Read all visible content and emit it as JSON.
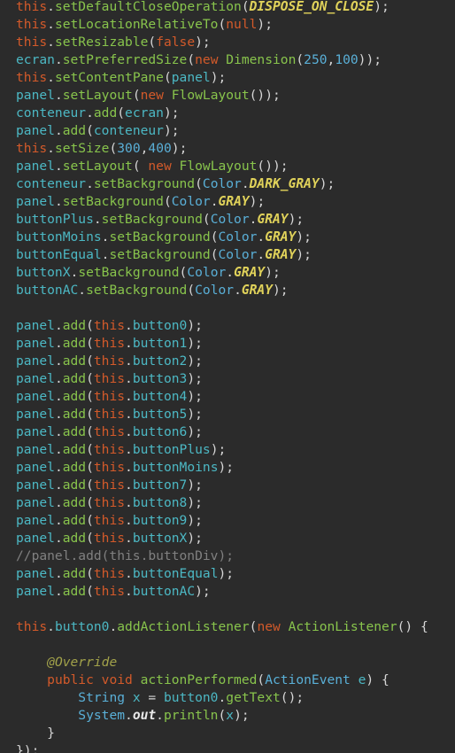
{
  "editor": {
    "language": "java",
    "colors": {
      "background": "#2b2b2b",
      "keyword": "#d35a2a",
      "identifier": "#4cb8c4",
      "method": "#88c44c",
      "type": "#5ab0d8",
      "constant": "#e0d25a",
      "number": "#5ab0d8",
      "plain": "#d6d6d6",
      "comment": "#808080",
      "annotation": "#a2a24a"
    },
    "lines": [
      [
        [
          "kw",
          "this"
        ],
        [
          "plain",
          "."
        ],
        [
          "method",
          "setDefaultCloseOperation"
        ],
        [
          "plain",
          "("
        ],
        [
          "const",
          "DISPOSE_ON_CLOSE"
        ],
        [
          "plain",
          ");"
        ]
      ],
      [
        [
          "kw",
          "this"
        ],
        [
          "plain",
          "."
        ],
        [
          "method",
          "setLocationRelativeTo"
        ],
        [
          "plain",
          "("
        ],
        [
          "kw",
          "null"
        ],
        [
          "plain",
          ");"
        ]
      ],
      [
        [
          "kw",
          "this"
        ],
        [
          "plain",
          "."
        ],
        [
          "method",
          "setResizable"
        ],
        [
          "plain",
          "("
        ],
        [
          "kw",
          "false"
        ],
        [
          "plain",
          ");"
        ]
      ],
      [
        [
          "var",
          "ecran"
        ],
        [
          "plain",
          "."
        ],
        [
          "method",
          "setPreferredSize"
        ],
        [
          "plain",
          "("
        ],
        [
          "kw",
          "new "
        ],
        [
          "method",
          "Dimension"
        ],
        [
          "plain",
          "("
        ],
        [
          "num",
          "250"
        ],
        [
          "plain",
          ","
        ],
        [
          "num",
          "100"
        ],
        [
          "plain",
          "));"
        ]
      ],
      [
        [
          "kw",
          "this"
        ],
        [
          "plain",
          "."
        ],
        [
          "method",
          "setContentPane"
        ],
        [
          "plain",
          "("
        ],
        [
          "var",
          "panel"
        ],
        [
          "plain",
          ");"
        ]
      ],
      [
        [
          "var",
          "panel"
        ],
        [
          "plain",
          "."
        ],
        [
          "method",
          "setLayout"
        ],
        [
          "plain",
          "("
        ],
        [
          "kw",
          "new "
        ],
        [
          "method",
          "FlowLayout"
        ],
        [
          "plain",
          "());"
        ]
      ],
      [
        [
          "var",
          "conteneur"
        ],
        [
          "plain",
          "."
        ],
        [
          "method",
          "add"
        ],
        [
          "plain",
          "("
        ],
        [
          "var",
          "ecran"
        ],
        [
          "plain",
          ");"
        ]
      ],
      [
        [
          "var",
          "panel"
        ],
        [
          "plain",
          "."
        ],
        [
          "method",
          "add"
        ],
        [
          "plain",
          "("
        ],
        [
          "var",
          "conteneur"
        ],
        [
          "plain",
          ");"
        ]
      ],
      [
        [
          "kw",
          "this"
        ],
        [
          "plain",
          "."
        ],
        [
          "method",
          "setSize"
        ],
        [
          "plain",
          "("
        ],
        [
          "num",
          "300"
        ],
        [
          "plain",
          ","
        ],
        [
          "num",
          "400"
        ],
        [
          "plain",
          ");"
        ]
      ],
      [
        [
          "var",
          "panel"
        ],
        [
          "plain",
          "."
        ],
        [
          "method",
          "setLayout"
        ],
        [
          "plain",
          "( "
        ],
        [
          "kw",
          "new "
        ],
        [
          "method",
          "FlowLayout"
        ],
        [
          "plain",
          "());"
        ]
      ],
      [
        [
          "var",
          "conteneur"
        ],
        [
          "plain",
          "."
        ],
        [
          "method",
          "setBackground"
        ],
        [
          "plain",
          "("
        ],
        [
          "type",
          "Color"
        ],
        [
          "plain",
          "."
        ],
        [
          "const",
          "DARK_GRAY"
        ],
        [
          "plain",
          ");"
        ]
      ],
      [
        [
          "var",
          "panel"
        ],
        [
          "plain",
          "."
        ],
        [
          "method",
          "setBackground"
        ],
        [
          "plain",
          "("
        ],
        [
          "type",
          "Color"
        ],
        [
          "plain",
          "."
        ],
        [
          "const",
          "GRAY"
        ],
        [
          "plain",
          ");"
        ]
      ],
      [
        [
          "var",
          "buttonPlus"
        ],
        [
          "plain",
          "."
        ],
        [
          "method",
          "setBackground"
        ],
        [
          "plain",
          "("
        ],
        [
          "type",
          "Color"
        ],
        [
          "plain",
          "."
        ],
        [
          "const",
          "GRAY"
        ],
        [
          "plain",
          ");"
        ]
      ],
      [
        [
          "var",
          "buttonMoins"
        ],
        [
          "plain",
          "."
        ],
        [
          "method",
          "setBackground"
        ],
        [
          "plain",
          "("
        ],
        [
          "type",
          "Color"
        ],
        [
          "plain",
          "."
        ],
        [
          "const",
          "GRAY"
        ],
        [
          "plain",
          ");"
        ]
      ],
      [
        [
          "var",
          "buttonEqual"
        ],
        [
          "plain",
          "."
        ],
        [
          "method",
          "setBackground"
        ],
        [
          "plain",
          "("
        ],
        [
          "type",
          "Color"
        ],
        [
          "plain",
          "."
        ],
        [
          "const",
          "GRAY"
        ],
        [
          "plain",
          ");"
        ]
      ],
      [
        [
          "var",
          "buttonX"
        ],
        [
          "plain",
          "."
        ],
        [
          "method",
          "setBackground"
        ],
        [
          "plain",
          "("
        ],
        [
          "type",
          "Color"
        ],
        [
          "plain",
          "."
        ],
        [
          "const",
          "GRAY"
        ],
        [
          "plain",
          ");"
        ]
      ],
      [
        [
          "var",
          "buttonAC"
        ],
        [
          "plain",
          "."
        ],
        [
          "method",
          "setBackground"
        ],
        [
          "plain",
          "("
        ],
        [
          "type",
          "Color"
        ],
        [
          "plain",
          "."
        ],
        [
          "const",
          "GRAY"
        ],
        [
          "plain",
          ");"
        ]
      ],
      [],
      [
        [
          "var",
          "panel"
        ],
        [
          "plain",
          "."
        ],
        [
          "method",
          "add"
        ],
        [
          "plain",
          "("
        ],
        [
          "kw",
          "this"
        ],
        [
          "plain",
          "."
        ],
        [
          "var",
          "button0"
        ],
        [
          "plain",
          ");"
        ]
      ],
      [
        [
          "var",
          "panel"
        ],
        [
          "plain",
          "."
        ],
        [
          "method",
          "add"
        ],
        [
          "plain",
          "("
        ],
        [
          "kw",
          "this"
        ],
        [
          "plain",
          "."
        ],
        [
          "var",
          "button1"
        ],
        [
          "plain",
          ");"
        ]
      ],
      [
        [
          "var",
          "panel"
        ],
        [
          "plain",
          "."
        ],
        [
          "method",
          "add"
        ],
        [
          "plain",
          "("
        ],
        [
          "kw",
          "this"
        ],
        [
          "plain",
          "."
        ],
        [
          "var",
          "button2"
        ],
        [
          "plain",
          ");"
        ]
      ],
      [
        [
          "var",
          "panel"
        ],
        [
          "plain",
          "."
        ],
        [
          "method",
          "add"
        ],
        [
          "plain",
          "("
        ],
        [
          "kw",
          "this"
        ],
        [
          "plain",
          "."
        ],
        [
          "var",
          "button3"
        ],
        [
          "plain",
          ");"
        ]
      ],
      [
        [
          "var",
          "panel"
        ],
        [
          "plain",
          "."
        ],
        [
          "method",
          "add"
        ],
        [
          "plain",
          "("
        ],
        [
          "kw",
          "this"
        ],
        [
          "plain",
          "."
        ],
        [
          "var",
          "button4"
        ],
        [
          "plain",
          ");"
        ]
      ],
      [
        [
          "var",
          "panel"
        ],
        [
          "plain",
          "."
        ],
        [
          "method",
          "add"
        ],
        [
          "plain",
          "("
        ],
        [
          "kw",
          "this"
        ],
        [
          "plain",
          "."
        ],
        [
          "var",
          "button5"
        ],
        [
          "plain",
          ");"
        ]
      ],
      [
        [
          "var",
          "panel"
        ],
        [
          "plain",
          "."
        ],
        [
          "method",
          "add"
        ],
        [
          "plain",
          "("
        ],
        [
          "kw",
          "this"
        ],
        [
          "plain",
          "."
        ],
        [
          "var",
          "button6"
        ],
        [
          "plain",
          ");"
        ]
      ],
      [
        [
          "var",
          "panel"
        ],
        [
          "plain",
          "."
        ],
        [
          "method",
          "add"
        ],
        [
          "plain",
          "("
        ],
        [
          "kw",
          "this"
        ],
        [
          "plain",
          "."
        ],
        [
          "var",
          "buttonPlus"
        ],
        [
          "plain",
          ");"
        ]
      ],
      [
        [
          "var",
          "panel"
        ],
        [
          "plain",
          "."
        ],
        [
          "method",
          "add"
        ],
        [
          "plain",
          "("
        ],
        [
          "kw",
          "this"
        ],
        [
          "plain",
          "."
        ],
        [
          "var",
          "buttonMoins"
        ],
        [
          "plain",
          ");"
        ]
      ],
      [
        [
          "var",
          "panel"
        ],
        [
          "plain",
          "."
        ],
        [
          "method",
          "add"
        ],
        [
          "plain",
          "("
        ],
        [
          "kw",
          "this"
        ],
        [
          "plain",
          "."
        ],
        [
          "var",
          "button7"
        ],
        [
          "plain",
          ");"
        ]
      ],
      [
        [
          "var",
          "panel"
        ],
        [
          "plain",
          "."
        ],
        [
          "method",
          "add"
        ],
        [
          "plain",
          "("
        ],
        [
          "kw",
          "this"
        ],
        [
          "plain",
          "."
        ],
        [
          "var",
          "button8"
        ],
        [
          "plain",
          ");"
        ]
      ],
      [
        [
          "var",
          "panel"
        ],
        [
          "plain",
          "."
        ],
        [
          "method",
          "add"
        ],
        [
          "plain",
          "("
        ],
        [
          "kw",
          "this"
        ],
        [
          "plain",
          "."
        ],
        [
          "var",
          "button9"
        ],
        [
          "plain",
          ");"
        ]
      ],
      [
        [
          "var",
          "panel"
        ],
        [
          "plain",
          "."
        ],
        [
          "method",
          "add"
        ],
        [
          "plain",
          "("
        ],
        [
          "kw",
          "this"
        ],
        [
          "plain",
          "."
        ],
        [
          "var",
          "buttonX"
        ],
        [
          "plain",
          ");"
        ]
      ],
      [
        [
          "comment",
          "//panel.add(this.buttonDiv);"
        ]
      ],
      [
        [
          "var",
          "panel"
        ],
        [
          "plain",
          "."
        ],
        [
          "method",
          "add"
        ],
        [
          "plain",
          "("
        ],
        [
          "kw",
          "this"
        ],
        [
          "plain",
          "."
        ],
        [
          "var",
          "buttonEqual"
        ],
        [
          "plain",
          ");"
        ]
      ],
      [
        [
          "var",
          "panel"
        ],
        [
          "plain",
          "."
        ],
        [
          "method",
          "add"
        ],
        [
          "plain",
          "("
        ],
        [
          "kw",
          "this"
        ],
        [
          "plain",
          "."
        ],
        [
          "var",
          "buttonAC"
        ],
        [
          "plain",
          ");"
        ]
      ],
      [],
      [
        [
          "kw",
          "this"
        ],
        [
          "plain",
          "."
        ],
        [
          "var",
          "button0"
        ],
        [
          "plain",
          "."
        ],
        [
          "method",
          "addActionListener"
        ],
        [
          "plain",
          "("
        ],
        [
          "kw",
          "new "
        ],
        [
          "method",
          "ActionListener"
        ],
        [
          "plain",
          "() {"
        ]
      ],
      [],
      [
        [
          "plain",
          "    "
        ],
        [
          "anno",
          "@Override"
        ]
      ],
      [
        [
          "plain",
          "    "
        ],
        [
          "kw",
          "public void "
        ],
        [
          "method",
          "actionPerformed"
        ],
        [
          "plain",
          "("
        ],
        [
          "type",
          "ActionEvent "
        ],
        [
          "var",
          "e"
        ],
        [
          "plain",
          ") {"
        ]
      ],
      [
        [
          "plain",
          "        "
        ],
        [
          "type",
          "String "
        ],
        [
          "var",
          "x"
        ],
        [
          "plain",
          " = "
        ],
        [
          "var",
          "button0"
        ],
        [
          "plain",
          "."
        ],
        [
          "method",
          "getText"
        ],
        [
          "plain",
          "();"
        ]
      ],
      [
        [
          "plain",
          "        "
        ],
        [
          "type",
          "System"
        ],
        [
          "plain",
          "."
        ],
        [
          "static",
          "out"
        ],
        [
          "plain",
          "."
        ],
        [
          "method",
          "println"
        ],
        [
          "plain",
          "("
        ],
        [
          "var",
          "x"
        ],
        [
          "plain",
          ");"
        ]
      ],
      [
        [
          "plain",
          "    }"
        ]
      ],
      [
        [
          "plain",
          "});"
        ]
      ]
    ]
  }
}
